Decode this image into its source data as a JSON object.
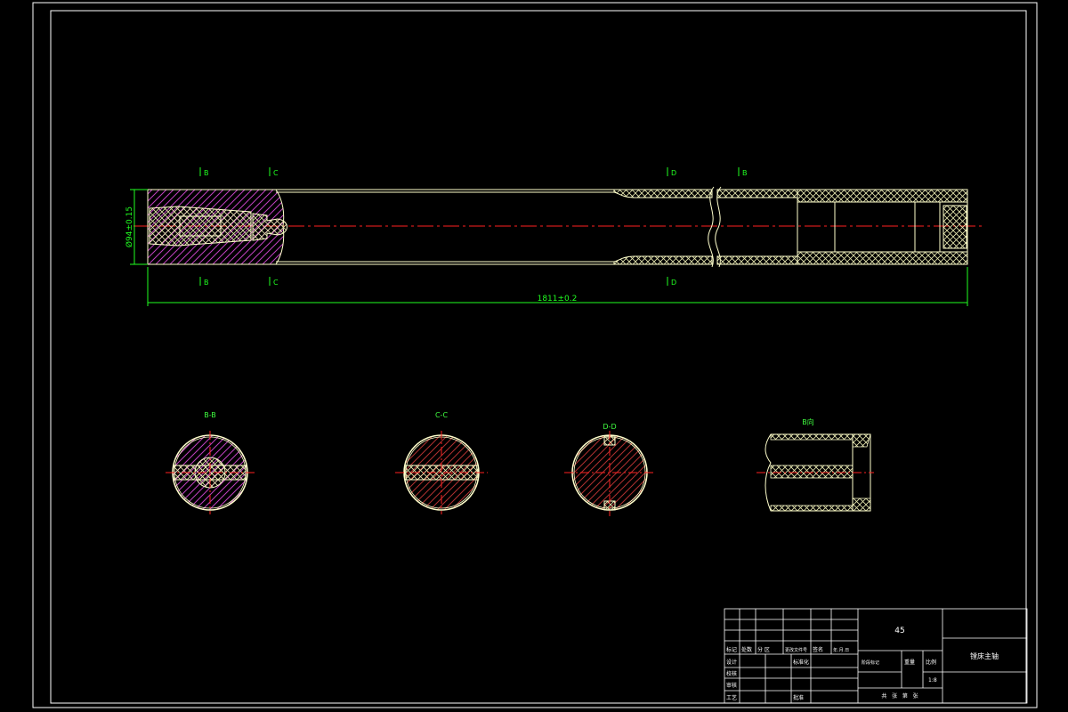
{
  "drawing": {
    "colors": {
      "background": "#000000",
      "frame": "#ffffff",
      "outline": "#ffffcc",
      "hatch_metal": "#c040c0",
      "hatch_cross": "#e8e8b0",
      "centerline": "#ff2020",
      "dimension": "#20ff20",
      "section_label": "#40ff40"
    },
    "main_view": {
      "section_marks": [
        "B",
        "C",
        "D",
        "B"
      ],
      "section_marks_bottom": [
        "B",
        "C",
        "D"
      ],
      "overall_length_dim": "1811±0.2",
      "diameter_dim": "Ø94±0.15"
    },
    "section_views": [
      {
        "title": "B-B"
      },
      {
        "title": "C-C"
      },
      {
        "title": "D-D"
      }
    ],
    "detail_view": {
      "title": "B向"
    }
  },
  "title_block": {
    "material": "45",
    "part_name": "镗床主轴",
    "header_row": [
      "标记",
      "处数",
      "分  区",
      "更改文件号",
      "签名",
      "年.月.日"
    ],
    "roles": [
      "设计",
      "校核",
      "审核",
      "工艺"
    ],
    "std_label": "标准化",
    "approve_label": "批准",
    "stage_label": "阶段标记",
    "weight_label": "重量",
    "scale_label": "比例",
    "scale": "1:8",
    "sheet_info": "共   张   第   张"
  }
}
